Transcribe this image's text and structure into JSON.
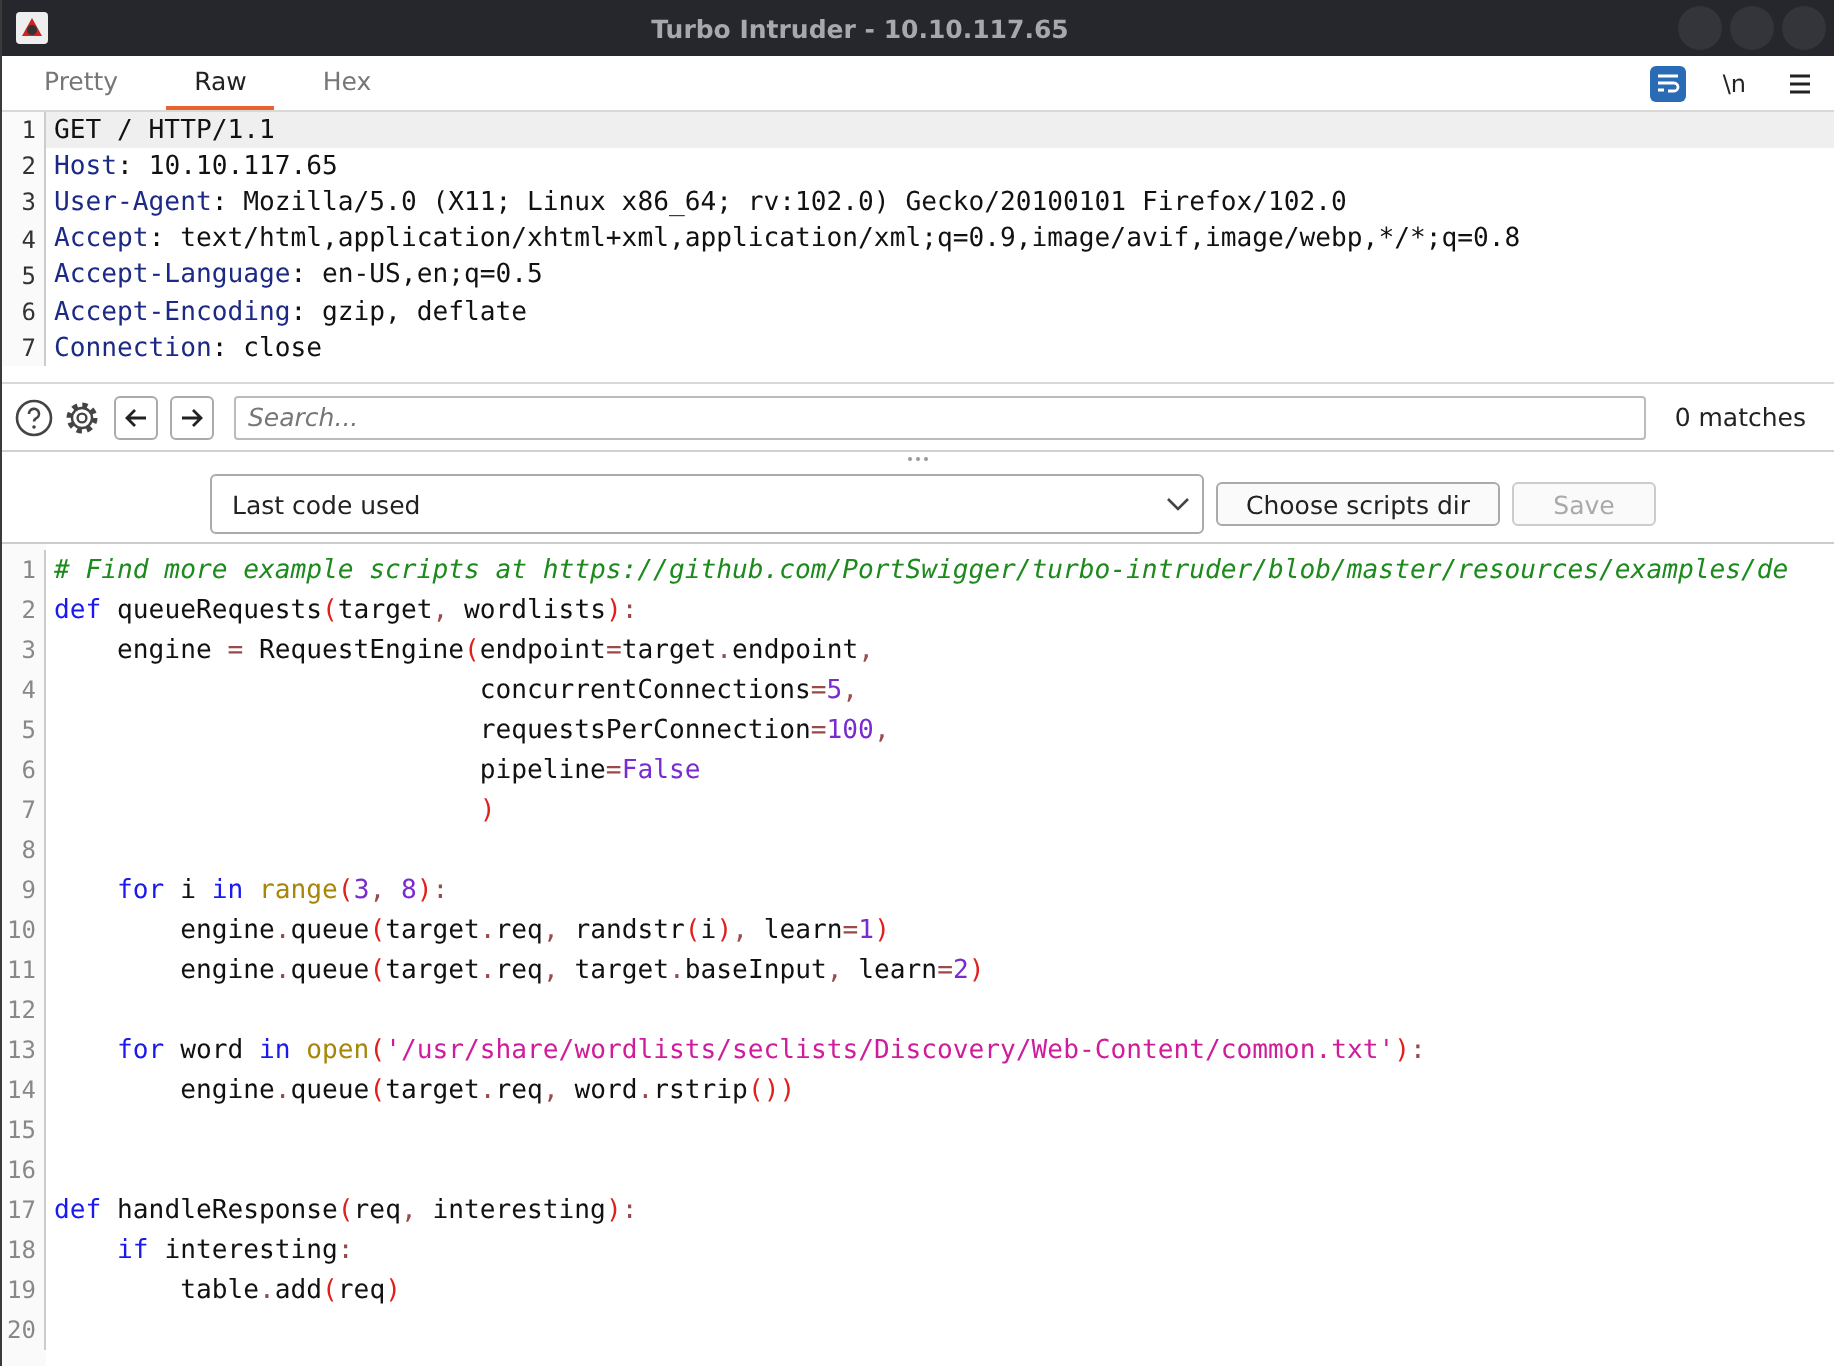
{
  "window": {
    "title": "Turbo Intruder - 10.10.117.65"
  },
  "tabs": [
    {
      "label": "Pretty",
      "selected": false
    },
    {
      "label": "Raw",
      "selected": true
    },
    {
      "label": "Hex",
      "selected": false
    }
  ],
  "toolbar": {
    "wrap_lines": true,
    "newline_label": "\\n",
    "show_newlines": false
  },
  "request": {
    "lines": [
      {
        "number": "1",
        "highlighted": true,
        "tokens": [
          {
            "kind": "plain",
            "text": "GET / HTTP/1.1"
          }
        ]
      },
      {
        "number": "2",
        "highlighted": false,
        "tokens": [
          {
            "kind": "header",
            "text": "Host"
          },
          {
            "kind": "plain",
            "text": ": 10.10.117.65"
          }
        ]
      },
      {
        "number": "3",
        "highlighted": false,
        "tokens": [
          {
            "kind": "header",
            "text": "User-Agent"
          },
          {
            "kind": "plain",
            "text": ": Mozilla/5.0 (X11; Linux x86_64; rv:102.0) Gecko/20100101 Firefox/102.0"
          }
        ]
      },
      {
        "number": "4",
        "highlighted": false,
        "tokens": [
          {
            "kind": "header",
            "text": "Accept"
          },
          {
            "kind": "plain",
            "text": ": text/html,application/xhtml+xml,application/xml;q=0.9,image/avif,image/webp,*/*;q=0.8"
          }
        ]
      },
      {
        "number": "5",
        "highlighted": false,
        "tokens": [
          {
            "kind": "header",
            "text": "Accept-Language"
          },
          {
            "kind": "plain",
            "text": ": en-US,en;q=0.5"
          }
        ]
      },
      {
        "number": "6",
        "highlighted": false,
        "tokens": [
          {
            "kind": "header",
            "text": "Accept-Encoding"
          },
          {
            "kind": "plain",
            "text": ": gzip, deflate"
          }
        ]
      },
      {
        "number": "7",
        "highlighted": false,
        "tokens": [
          {
            "kind": "header",
            "text": "Connection"
          },
          {
            "kind": "plain",
            "text": ": close"
          }
        ]
      }
    ]
  },
  "search": {
    "placeholder": "Search...",
    "matches": "0 matches"
  },
  "script_select": {
    "value": "Last code used"
  },
  "buttons": [
    {
      "label": "Choose scripts dir",
      "disabled": false
    },
    {
      "label": "Save",
      "disabled": true
    }
  ],
  "code": {
    "lines": [
      {
        "number": "1",
        "tokens": [
          {
            "kind": "comment",
            "text": "# Find more example scripts at https://github.com/PortSwigger/turbo-intruder/blob/master/resources/examples/de"
          }
        ]
      },
      {
        "number": "2",
        "tokens": [
          {
            "kind": "keyword",
            "text": "def"
          },
          {
            "kind": "plain",
            "text": " queueRequests"
          },
          {
            "kind": "paren",
            "text": "("
          },
          {
            "kind": "plain",
            "text": "target"
          },
          {
            "kind": "op",
            "text": ","
          },
          {
            "kind": "plain",
            "text": " wordlists"
          },
          {
            "kind": "paren",
            "text": ")"
          },
          {
            "kind": "op",
            "text": ":"
          }
        ]
      },
      {
        "number": "3",
        "tokens": [
          {
            "kind": "plain",
            "text": "    engine "
          },
          {
            "kind": "op",
            "text": "="
          },
          {
            "kind": "plain",
            "text": " RequestEngine"
          },
          {
            "kind": "paren",
            "text": "("
          },
          {
            "kind": "plain",
            "text": "endpoint"
          },
          {
            "kind": "op",
            "text": "="
          },
          {
            "kind": "plain",
            "text": "target"
          },
          {
            "kind": "op",
            "text": "."
          },
          {
            "kind": "plain",
            "text": "endpoint"
          },
          {
            "kind": "op",
            "text": ","
          }
        ]
      },
      {
        "number": "4",
        "tokens": [
          {
            "kind": "plain",
            "text": "                           concurrentConnections"
          },
          {
            "kind": "op",
            "text": "="
          },
          {
            "kind": "number",
            "text": "5"
          },
          {
            "kind": "op",
            "text": ","
          }
        ]
      },
      {
        "number": "5",
        "tokens": [
          {
            "kind": "plain",
            "text": "                           requestsPerConnection"
          },
          {
            "kind": "op",
            "text": "="
          },
          {
            "kind": "number",
            "text": "100"
          },
          {
            "kind": "op",
            "text": ","
          }
        ]
      },
      {
        "number": "6",
        "tokens": [
          {
            "kind": "plain",
            "text": "                           pipeline"
          },
          {
            "kind": "op",
            "text": "="
          },
          {
            "kind": "number",
            "text": "False"
          }
        ]
      },
      {
        "number": "7",
        "tokens": [
          {
            "kind": "paren",
            "text": "                           )"
          }
        ]
      },
      {
        "number": "8"
      },
      {
        "number": "9",
        "tokens": [
          {
            "kind": "keyword",
            "text": "    for"
          },
          {
            "kind": "plain",
            "text": " i "
          },
          {
            "kind": "keyword",
            "text": "in "
          },
          {
            "kind": "builtin",
            "text": "range"
          },
          {
            "kind": "paren",
            "text": "("
          },
          {
            "kind": "number",
            "text": "3"
          },
          {
            "kind": "op",
            "text": ","
          },
          {
            "kind": "number",
            "text": " 8"
          },
          {
            "kind": "paren",
            "text": ")"
          },
          {
            "kind": "op",
            "text": ":"
          }
        ]
      },
      {
        "number": "10",
        "tokens": [
          {
            "kind": "plain",
            "text": "        engine"
          },
          {
            "kind": "op",
            "text": "."
          },
          {
            "kind": "plain",
            "text": "queue"
          },
          {
            "kind": "paren",
            "text": "("
          },
          {
            "kind": "plain",
            "text": "target"
          },
          {
            "kind": "op",
            "text": "."
          },
          {
            "kind": "plain",
            "text": "req"
          },
          {
            "kind": "op",
            "text": ","
          },
          {
            "kind": "plain",
            "text": " randstr"
          },
          {
            "kind": "paren",
            "text": "("
          },
          {
            "kind": "plain",
            "text": "i"
          },
          {
            "kind": "paren",
            "text": ")"
          },
          {
            "kind": "op",
            "text": ","
          },
          {
            "kind": "plain",
            "text": " learn"
          },
          {
            "kind": "op",
            "text": "="
          },
          {
            "kind": "number",
            "text": "1"
          },
          {
            "kind": "paren",
            "text": ")"
          }
        ]
      },
      {
        "number": "11",
        "tokens": [
          {
            "kind": "plain",
            "text": "        engine"
          },
          {
            "kind": "op",
            "text": "."
          },
          {
            "kind": "plain",
            "text": "queue"
          },
          {
            "kind": "paren",
            "text": "("
          },
          {
            "kind": "plain",
            "text": "target"
          },
          {
            "kind": "op",
            "text": "."
          },
          {
            "kind": "plain",
            "text": "req"
          },
          {
            "kind": "op",
            "text": ","
          },
          {
            "kind": "plain",
            "text": " target"
          },
          {
            "kind": "op",
            "text": "."
          },
          {
            "kind": "plain",
            "text": "baseInput"
          },
          {
            "kind": "op",
            "text": ","
          },
          {
            "kind": "plain",
            "text": " learn"
          },
          {
            "kind": "op",
            "text": "="
          },
          {
            "kind": "number",
            "text": "2"
          },
          {
            "kind": "paren",
            "text": ")"
          }
        ]
      },
      {
        "number": "12"
      },
      {
        "number": "13",
        "tokens": [
          {
            "kind": "keyword",
            "text": "    for"
          },
          {
            "kind": "plain",
            "text": " word "
          },
          {
            "kind": "keyword",
            "text": "in "
          },
          {
            "kind": "builtin",
            "text": "open"
          },
          {
            "kind": "paren",
            "text": "("
          },
          {
            "kind": "string",
            "text": "'/usr/share/wordlists/seclists/Discovery/Web-Content/common.txt'"
          },
          {
            "kind": "paren",
            "text": ")"
          },
          {
            "kind": "op",
            "text": ":"
          }
        ]
      },
      {
        "number": "14",
        "tokens": [
          {
            "kind": "plain",
            "text": "        engine"
          },
          {
            "kind": "op",
            "text": "."
          },
          {
            "kind": "plain",
            "text": "queue"
          },
          {
            "kind": "paren",
            "text": "("
          },
          {
            "kind": "plain",
            "text": "target"
          },
          {
            "kind": "op",
            "text": "."
          },
          {
            "kind": "plain",
            "text": "req"
          },
          {
            "kind": "op",
            "text": ","
          },
          {
            "kind": "plain",
            "text": " word"
          },
          {
            "kind": "op",
            "text": "."
          },
          {
            "kind": "plain",
            "text": "rstrip"
          },
          {
            "kind": "paren",
            "text": "())"
          }
        ]
      },
      {
        "number": "15"
      },
      {
        "number": "16"
      },
      {
        "number": "17",
        "tokens": [
          {
            "kind": "keyword",
            "text": "def"
          },
          {
            "kind": "plain",
            "text": " handleResponse"
          },
          {
            "kind": "paren",
            "text": "("
          },
          {
            "kind": "plain",
            "text": "req"
          },
          {
            "kind": "op",
            "text": ","
          },
          {
            "kind": "plain",
            "text": " interesting"
          },
          {
            "kind": "paren",
            "text": ")"
          },
          {
            "kind": "op",
            "text": ":"
          }
        ]
      },
      {
        "number": "18",
        "tokens": [
          {
            "kind": "keyword",
            "text": "    if"
          },
          {
            "kind": "plain",
            "text": " interesting"
          },
          {
            "kind": "op",
            "text": ":"
          }
        ]
      },
      {
        "number": "19",
        "tokens": [
          {
            "kind": "plain",
            "text": "        table"
          },
          {
            "kind": "op",
            "text": "."
          },
          {
            "kind": "plain",
            "text": "add"
          },
          {
            "kind": "paren",
            "text": "("
          },
          {
            "kind": "plain",
            "text": "req"
          },
          {
            "kind": "paren",
            "text": ")"
          }
        ]
      },
      {
        "number": "20"
      }
    ]
  }
}
